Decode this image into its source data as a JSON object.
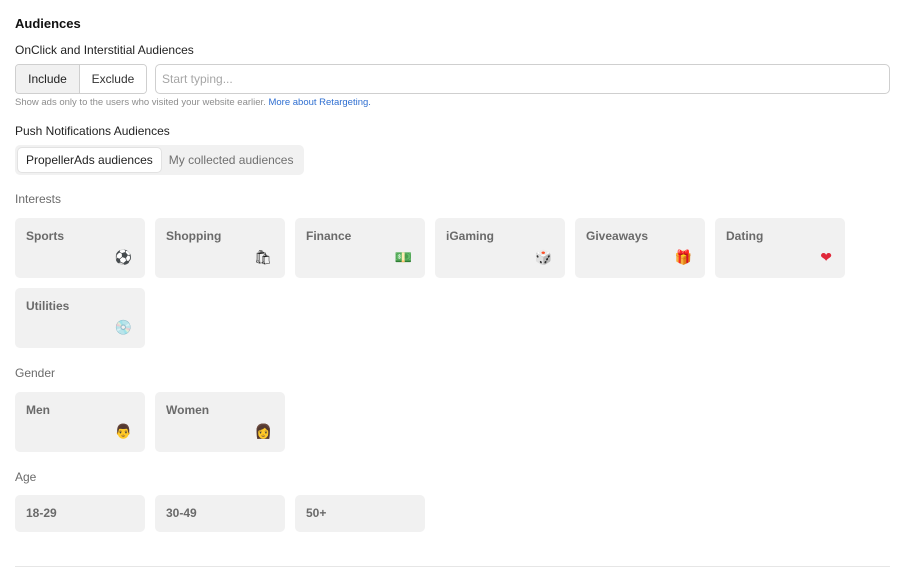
{
  "section_title": "Audiences",
  "onclick": {
    "label": "OnClick and Interstitial Audiences",
    "include_label": "Include",
    "exclude_label": "Exclude",
    "input_placeholder": "Start typing...",
    "hint_text": "Show ads only to the users who visited your website earlier.",
    "hint_link": "More about Retargeting."
  },
  "push": {
    "label": "Push Notifications Audiences",
    "tab_propeller": "PropellerAds audiences",
    "tab_collected": "My collected audiences"
  },
  "interests": {
    "label": "Interests",
    "items": [
      {
        "label": "Sports",
        "icon": "soccer-ball-icon",
        "glyph": "⚽"
      },
      {
        "label": "Shopping",
        "icon": "shopping-bag-icon",
        "glyph": "🛍"
      },
      {
        "label": "Finance",
        "icon": "money-icon",
        "glyph": "💵"
      },
      {
        "label": "iGaming",
        "icon": "dice-icon",
        "glyph": "🎲"
      },
      {
        "label": "Giveaways",
        "icon": "gift-icon",
        "glyph": "🎁"
      },
      {
        "label": "Dating",
        "icon": "heart-icon",
        "glyph": "❤"
      },
      {
        "label": "Utilities",
        "icon": "disc-icon",
        "glyph": "💿"
      }
    ]
  },
  "gender": {
    "label": "Gender",
    "items": [
      {
        "label": "Men",
        "icon": "man-face-icon",
        "glyph": "👨"
      },
      {
        "label": "Women",
        "icon": "woman-face-icon",
        "glyph": "👩"
      }
    ]
  },
  "age": {
    "label": "Age",
    "items": [
      {
        "label": "18-29"
      },
      {
        "label": "30-49"
      },
      {
        "label": "50+"
      }
    ]
  }
}
